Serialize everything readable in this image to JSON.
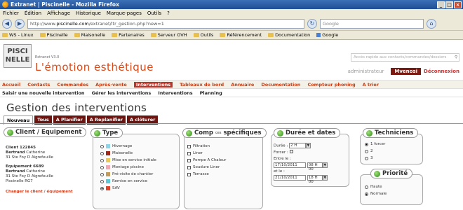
{
  "window": {
    "title": "Extranet | Piscinelle - Mozilla Firefox"
  },
  "menubar": [
    "Fichier",
    "Édition",
    "Affichage",
    "Historique",
    "Marque-pages",
    "Outils",
    "?"
  ],
  "nav": {
    "url_prefix": "http://www.",
    "url_domain": "piscinelle.com",
    "url_path": "/extranet/ltr_gestion.php?new=1",
    "search_placeholder": "Google"
  },
  "bookmarks": [
    "WS - Linux",
    "Piscinelle",
    "Maisonelle",
    "Partenaires",
    "Serveur OVH",
    "Outils",
    "Référencement",
    "Documentation",
    "Google"
  ],
  "header": {
    "logo_line1": "PISCI",
    "logo_line2": "NELLE",
    "extranet": "Extranet V3.0",
    "slogan": "L'émotion esthétique",
    "quick_search": "Accès rapide aux contacts/commandes/dossiers",
    "admin_label": "administrateur",
    "user": "Mvenosi",
    "logout": "Déconnexion"
  },
  "mainmenu": [
    "Accueil",
    "Contacts",
    "Commandes",
    "Après-vente",
    "Interventions",
    "Tableaux de bord",
    "Annuaire",
    "Documentation",
    "Compteur phoning",
    "A trier"
  ],
  "mainmenu_active": "Interventions",
  "submenu": [
    "Saisir une nouvelle intervention",
    "Gérer les interventions",
    "Interventions",
    "Planning"
  ],
  "page_title": "Gestion des interventions",
  "tabs": [
    "Nouveau",
    "Tous",
    "A Planifier",
    "A Replanifier",
    "A clôturer"
  ],
  "client": {
    "title": "Client / Equipement",
    "client_id": "Client 122845",
    "client_name_bold": "Bertrand",
    "client_name": "Catherine",
    "client_addr": "31 Ste Foy D Aigrefeuille",
    "equip_id": "Equipement 6689",
    "equip_name_bold": "Bertrand",
    "equip_name": "Catherine",
    "equip_addr": "31 Ste Foy D Aigrefeuille",
    "equip_model": "Piscinelle RG7",
    "change_link": "Changer le client / équipement"
  },
  "type": {
    "title": "Type",
    "options": [
      {
        "label": "Hivernage",
        "color": "#8fd3e8",
        "checked": false
      },
      {
        "label": "Maisonelle",
        "color": "#a0281a",
        "checked": false
      },
      {
        "label": "Mise en service initiale",
        "color": "#e9c95a",
        "checked": false
      },
      {
        "label": "Montage piscine",
        "color": "#f2a7b3",
        "checked": false
      },
      {
        "label": "Pré-visite de chantier",
        "color": "#c49a5a",
        "checked": false
      },
      {
        "label": "Remise en service",
        "color": "#5ec8d6",
        "checked": false
      },
      {
        "label": "SAV",
        "color": "#e0442a",
        "checked": true
      }
    ]
  },
  "comp": {
    "title_pre": "Comp",
    "title_sup": "ces",
    "title_post": " spécifiques",
    "options": [
      "Filtration",
      "Liner",
      "Pompe A Chaleur",
      "Soudure Liner",
      "Terrasse"
    ]
  },
  "duree": {
    "title": "Durée et dates",
    "duree_label": "Durée :",
    "duree_value": "2 H",
    "forcer_label": "Forcer :",
    "entre_label": "Entre le :",
    "date1": "17/10/2011",
    "time1": "08 H 00",
    "et_label": "et le :",
    "date2": "21/10/2011",
    "time2": "18 H 00"
  },
  "tech": {
    "title": "Techniciens",
    "options": [
      {
        "label": "1 forcer",
        "checked": true
      },
      {
        "label": "2",
        "checked": false
      },
      {
        "label": "3",
        "checked": false
      }
    ]
  },
  "priority": {
    "title": "Priorité",
    "options": [
      {
        "label": "Haute",
        "checked": false
      },
      {
        "label": "Normale",
        "checked": true
      }
    ]
  }
}
